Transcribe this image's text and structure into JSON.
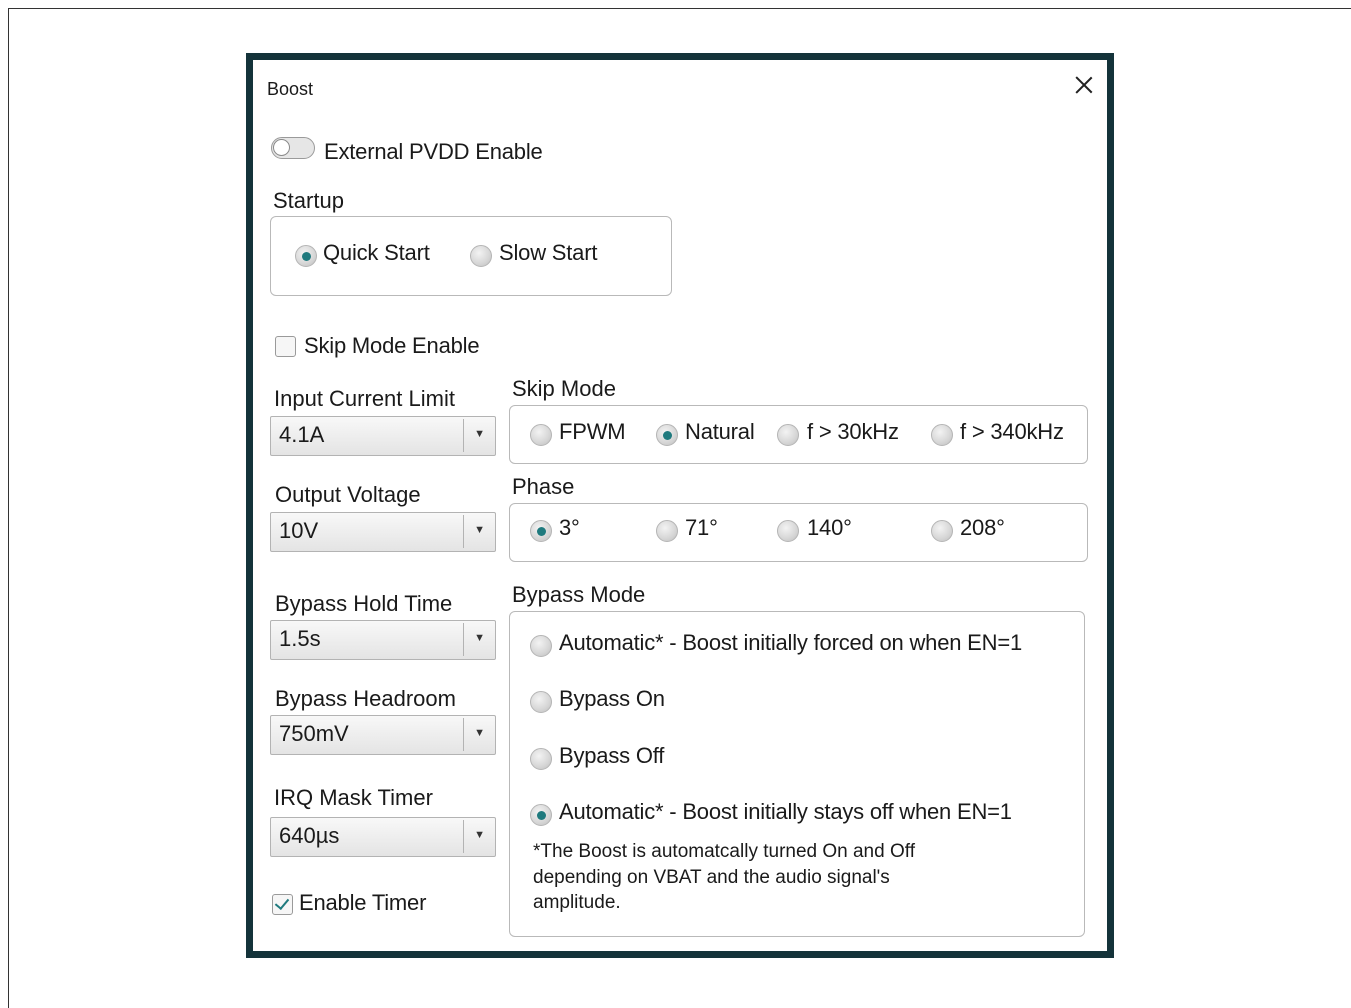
{
  "dialog": {
    "title": "Boost"
  },
  "external_pvdd": {
    "label": "External PVDD Enable",
    "enabled": false
  },
  "startup": {
    "heading": "Startup",
    "options": [
      "Quick Start",
      "Slow Start"
    ],
    "selected": "Quick Start"
  },
  "skip_mode_enable": {
    "label": "Skip Mode Enable",
    "checked": false
  },
  "input_current_limit": {
    "label": "Input Current Limit",
    "value": "4.1A"
  },
  "output_voltage": {
    "label": "Output Voltage",
    "value": "10V"
  },
  "bypass_hold_time": {
    "label": "Bypass Hold Time",
    "value": "1.5s"
  },
  "bypass_headroom": {
    "label": "Bypass Headroom",
    "value": "750mV"
  },
  "irq_mask_timer": {
    "label": "IRQ Mask Timer",
    "value": "640µs"
  },
  "enable_timer": {
    "label": "Enable Timer",
    "checked": true
  },
  "skip_mode": {
    "heading": "Skip Mode",
    "options": [
      "FPWM",
      "Natural",
      "f > 30kHz",
      "f > 340kHz"
    ],
    "selected": "Natural"
  },
  "phase": {
    "heading": "Phase",
    "options": [
      "3°",
      "71°",
      "140°",
      "208°"
    ],
    "selected": "3°"
  },
  "bypass_mode": {
    "heading": "Bypass Mode",
    "options": [
      "Automatic* - Boost initially  forced on when EN=1",
      "Bypass On",
      "Bypass Off",
      "Automatic* - Boost initially stays off when EN=1"
    ],
    "selected": "Automatic* - Boost initially stays off when EN=1",
    "note_lines": [
      "*The Boost is automatcally turned On and Off",
      "depending on VBAT and the audio signal's",
      "amplitude."
    ]
  },
  "icons": {
    "close": "close-icon",
    "dropdown": "chevron-down-icon"
  },
  "colors": {
    "accent": "#1f7a7e",
    "frame": "#14333a"
  }
}
